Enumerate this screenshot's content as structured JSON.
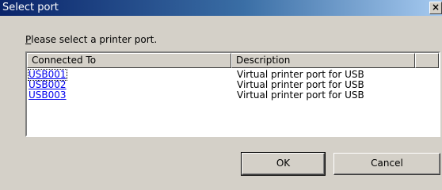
{
  "window": {
    "title": "Select port",
    "close_label": "×"
  },
  "prompt": {
    "accel": "P",
    "rest": "lease select a printer port."
  },
  "list": {
    "columns": [
      "Connected To",
      "Description",
      ""
    ],
    "rows": [
      {
        "port": "USB001",
        "description": "Virtual printer port for USB"
      },
      {
        "port": "USB002",
        "description": "Virtual printer port for USB"
      },
      {
        "port": "USB003",
        "description": "Virtual printer port for USB"
      }
    ]
  },
  "buttons": {
    "ok": "OK",
    "cancel": "Cancel"
  }
}
